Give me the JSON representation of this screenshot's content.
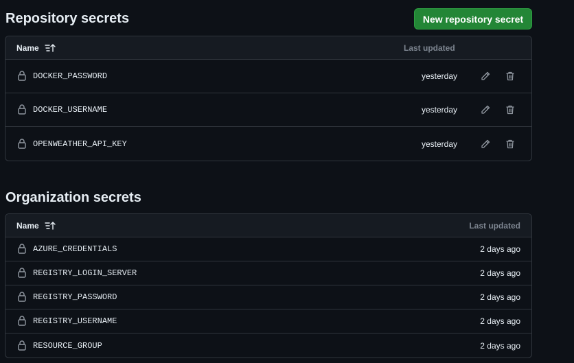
{
  "repository": {
    "title": "Repository secrets",
    "new_button_label": "New repository secret",
    "header": {
      "name": "Name",
      "last_updated": "Last updated"
    },
    "secrets": [
      {
        "name": "DOCKER_PASSWORD",
        "updated": "yesterday"
      },
      {
        "name": "DOCKER_USERNAME",
        "updated": "yesterday"
      },
      {
        "name": "OPENWEATHER_API_KEY",
        "updated": "yesterday"
      }
    ]
  },
  "organization": {
    "title": "Organization secrets",
    "header": {
      "name": "Name",
      "last_updated": "Last updated"
    },
    "secrets": [
      {
        "name": "AZURE_CREDENTIALS",
        "updated": "2 days ago"
      },
      {
        "name": "REGISTRY_LOGIN_SERVER",
        "updated": "2 days ago"
      },
      {
        "name": "REGISTRY_PASSWORD",
        "updated": "2 days ago"
      },
      {
        "name": "REGISTRY_USERNAME",
        "updated": "2 days ago"
      },
      {
        "name": "RESOURCE_GROUP",
        "updated": "2 days ago"
      }
    ]
  },
  "icons": {
    "sort": "sort-ascending-icon",
    "lock": "lock-icon",
    "edit": "pencil-icon",
    "delete": "trash-icon"
  },
  "colors": {
    "background": "#0d1117",
    "header_bg": "#161b22",
    "border": "#30363d",
    "primary_button": "#238636",
    "muted_text": "#7d8590"
  }
}
